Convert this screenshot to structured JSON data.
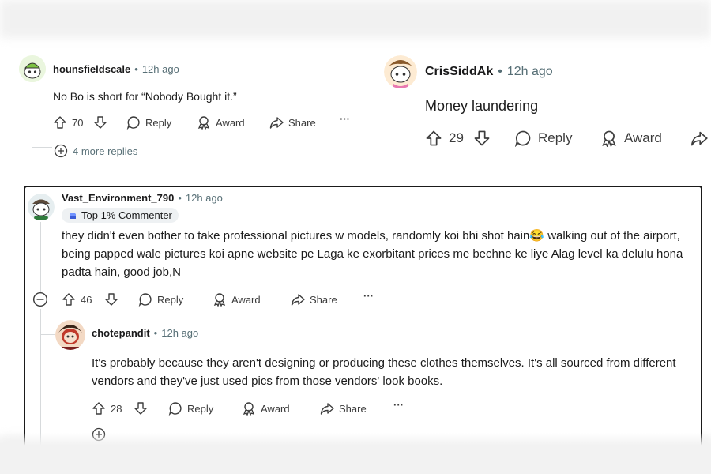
{
  "colors": {
    "meta": "#576f76",
    "border": "#1a1a1a",
    "bg": "#ffffff"
  },
  "comments": [
    {
      "username": "hounsfieldscale",
      "time": "12h ago",
      "text": "No Bo is short for “Nobody Bought it.”",
      "votes": "70",
      "reply": "Reply",
      "award": "Award",
      "share": "Share",
      "more": "···",
      "more_replies": "4 more replies"
    },
    {
      "username": "CrisSiddAk",
      "time": "12h ago",
      "text": "Money laundering",
      "votes": "29",
      "reply": "Reply",
      "award": "Award"
    },
    {
      "username": "Vast_Environment_790",
      "time": "12h ago",
      "badge": "Top 1% Commenter",
      "text": "they didn't even bother to take professional pictures w models, randomly koi bhi shot hain😂 walking out of the airport, being papped wale pictures koi apne website pe Laga ke exorbitant prices me bechne ke liye Alag level ka delulu hona padta hain, good job,N",
      "votes": "46",
      "reply": "Reply",
      "award": "Award",
      "share": "Share",
      "more": "···"
    },
    {
      "username": "chotepandit",
      "time": "12h ago",
      "text": "It's probably because they aren't designing or producing these clothes themselves. It's all sourced from different vendors and they've just used pics from those vendors' look books.",
      "votes": "28",
      "reply": "Reply",
      "award": "Award",
      "share": "Share",
      "more": "···"
    }
  ],
  "separator": "•"
}
